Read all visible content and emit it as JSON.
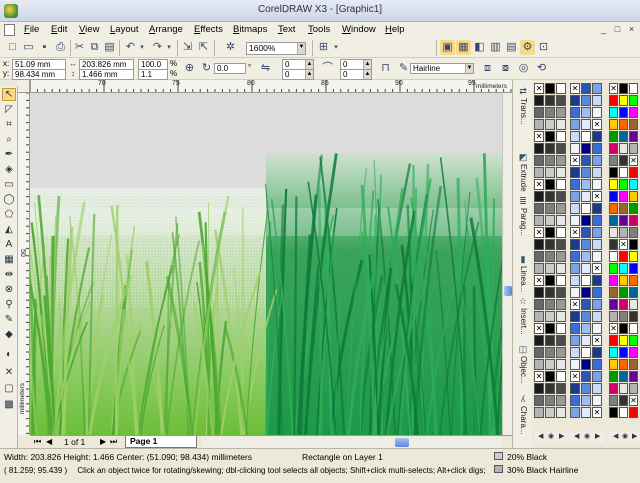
{
  "window": {
    "title": "CorelDRAW X3 - [Graphic1]"
  },
  "menu": {
    "items": [
      "File",
      "Edit",
      "View",
      "Layout",
      "Arrange",
      "Effects",
      "Bitmaps",
      "Text",
      "Tools",
      "Window",
      "Help"
    ],
    "window_controls": [
      "_",
      "□",
      "×"
    ]
  },
  "toolbar": {
    "zoom_level": "1600%"
  },
  "property_bar": {
    "x_value": "51.09 mm",
    "y_value": "98.434 mm",
    "width_value": "203.826 mm",
    "height_value": "1.466 mm",
    "scale_x": "100.0",
    "scale_y": "1.1",
    "scale_unit": "%",
    "rotation": "0.0",
    "corner_values": [
      "0",
      "0",
      "0",
      "0"
    ],
    "outline_width": "Hairline"
  },
  "ruler": {
    "h_ticks": [
      "70",
      "75",
      "80",
      "85",
      "90",
      "95"
    ],
    "h_unit": "millimeters",
    "v_ticks": [
      "50"
    ],
    "v_unit": "millimeters"
  },
  "pages": {
    "counter": "1 of 1",
    "current_tab": "Page 1"
  },
  "dockers": [
    {
      "label": "Trans...",
      "icon": "transform-icon"
    },
    {
      "label": "Extrude",
      "icon": "extrude-icon"
    },
    {
      "label": "Parag...",
      "icon": "paragraph-icon"
    },
    {
      "label": "Linea...",
      "icon": "linear-icon"
    },
    {
      "label": "Insert...",
      "icon": "insert-icon"
    },
    {
      "label": "Objec...",
      "icon": "object-icon"
    },
    {
      "label": "Chara...",
      "icon": "character-icon"
    }
  ],
  "status": {
    "dimensions": "Width: 203.826  Height: 1.466  Center: (51.090; 98.434)  millimeters",
    "object_info": "Rectangle on Layer 1",
    "cursor_pos": "( 81.259; 95.439 )",
    "hint": "Click an object twice for rotating/skewing; dbl-clicking tool selects all objects; Shift+click multi-selects; Alt+click digs; Ctrl+click...",
    "fill_label": "20% Black",
    "fill_color": "#cccccc",
    "outline_label": "30% Black  Hairline",
    "outline_color": "#b3b3b3"
  },
  "colors": {
    "grass_dark": "#1a8f3a",
    "grass_light": "#7cc243",
    "highlight": "#f8d98a"
  }
}
